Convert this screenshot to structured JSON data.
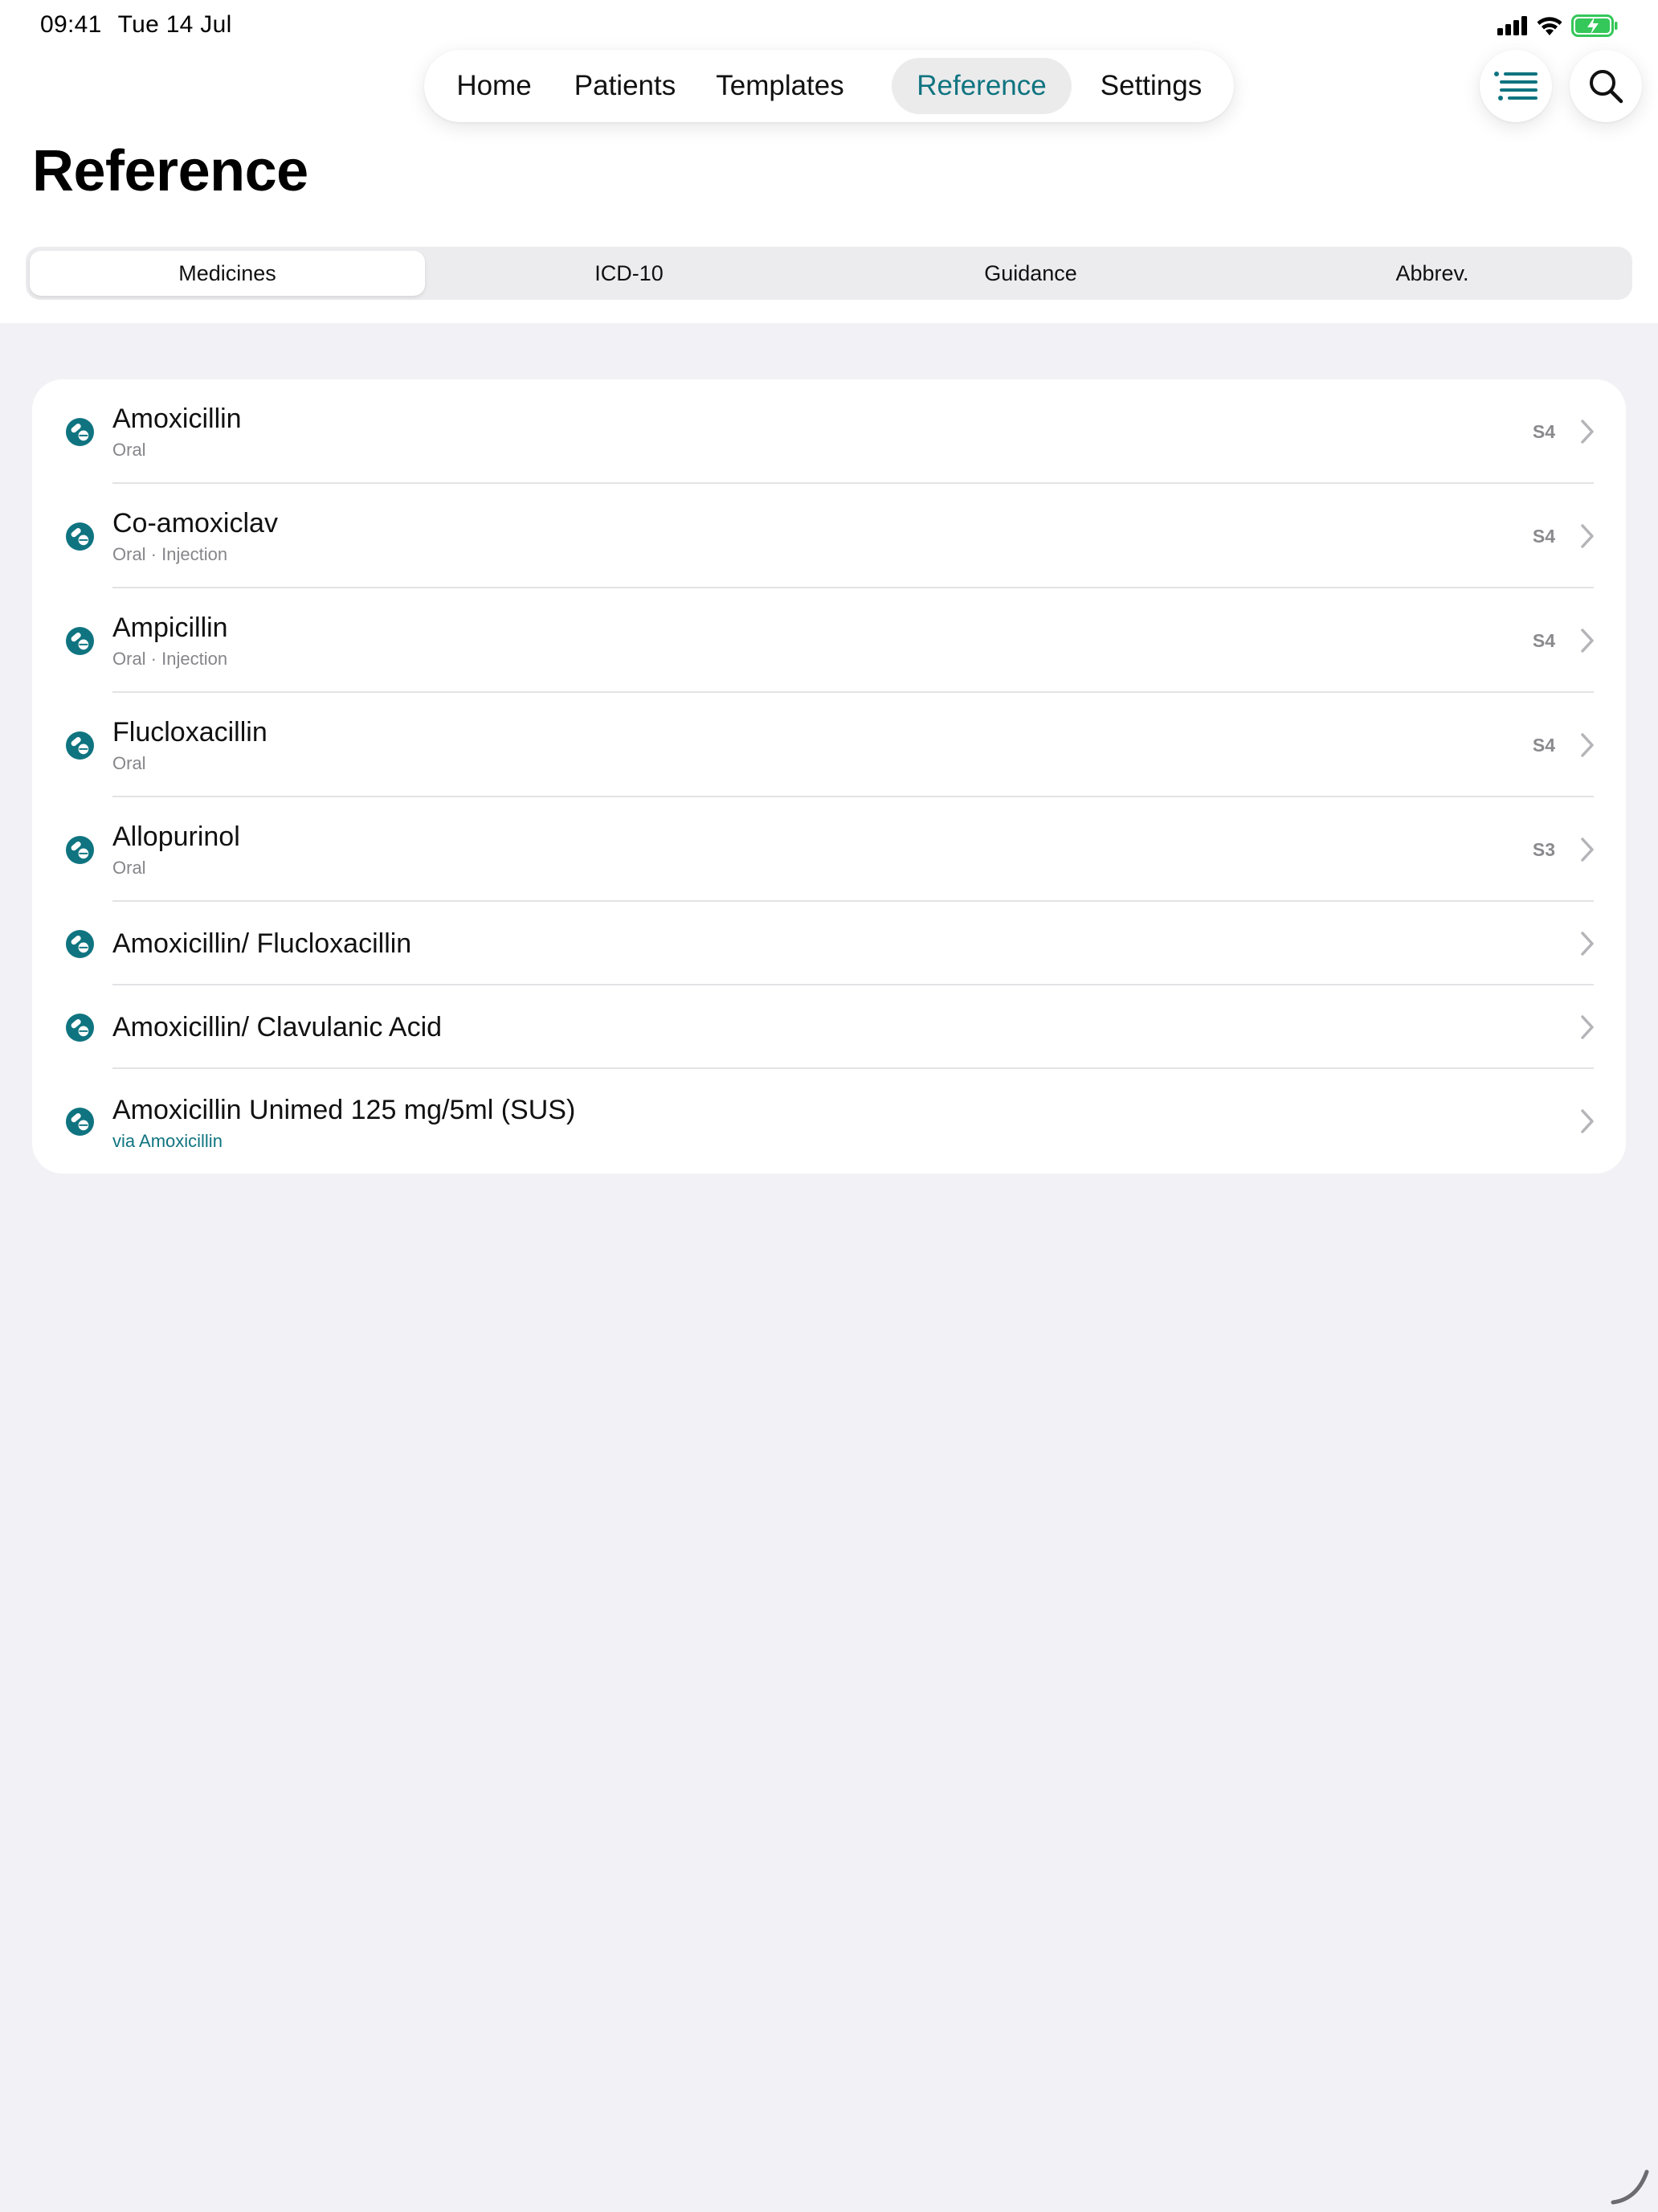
{
  "status_bar": {
    "time": "09:41",
    "date": "Tue 14 Jul"
  },
  "nav": {
    "tabs": [
      {
        "label": "Home"
      },
      {
        "label": "Patients"
      },
      {
        "label": "Templates"
      },
      {
        "label": "Reference",
        "active": true
      },
      {
        "label": "Settings"
      }
    ],
    "buttons": {
      "list_icon": "list-icon",
      "search_icon": "search-icon"
    }
  },
  "page": {
    "title": "Reference"
  },
  "segments": [
    {
      "label": "Medicines",
      "active": true
    },
    {
      "label": "ICD-10"
    },
    {
      "label": "Guidance"
    },
    {
      "label": "Abbrev."
    }
  ],
  "medicines": [
    {
      "name": "Amoxicillin",
      "sub": "Oral",
      "badge": "S4"
    },
    {
      "name": "Co-amoxiclav",
      "sub": "Oral · Injection",
      "badge": "S4"
    },
    {
      "name": "Ampicillin",
      "sub": "Oral · Injection",
      "badge": "S4"
    },
    {
      "name": "Flucloxacillin",
      "sub": "Oral",
      "badge": "S4"
    },
    {
      "name": "Allopurinol",
      "sub": "Oral",
      "badge": "S3"
    },
    {
      "name": "Amoxicillin/ Flucloxacillin"
    },
    {
      "name": "Amoxicillin/ Clavulanic Acid"
    },
    {
      "name": "Amoxicillin Unimed 125 mg/5ml (SUS)",
      "sub": "via Amoxicillin",
      "sub_is_link": true
    }
  ],
  "colors": {
    "accent": "#0f7480",
    "background": "#f2f2f6",
    "battery": "#34c759"
  }
}
